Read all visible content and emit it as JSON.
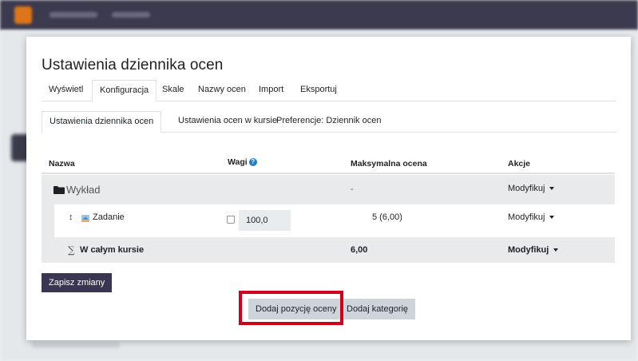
{
  "page": {
    "title": "Ustawienia dziennika ocen"
  },
  "tabs_primary": [
    {
      "label": "Wyświetl",
      "active": false
    },
    {
      "label": "Konfiguracja",
      "active": true
    },
    {
      "label": "Skale",
      "active": false
    },
    {
      "label": "Nazwy ocen",
      "active": false
    },
    {
      "label": "Import",
      "active": false
    },
    {
      "label": "Eksportuj",
      "active": false
    }
  ],
  "tabs_secondary": [
    {
      "label": "Ustawienia dziennika ocen",
      "active": true
    },
    {
      "label": "Ustawienia ocen w kursie",
      "active": false
    },
    {
      "label": "Preferencje: Dziennik ocen",
      "active": false
    }
  ],
  "table": {
    "headers": {
      "name": "Nazwa",
      "weights": "Wagi",
      "max_grade": "Maksymalna ocena",
      "actions": "Akcje"
    },
    "category_row": {
      "name": "Wykład",
      "max_grade": "-",
      "action": "Modyfikuj"
    },
    "item_row": {
      "name": "Zadanie",
      "weight_checked": false,
      "weight_value": "100,0",
      "max_grade": "5 (6,00)",
      "action": "Modyfikuj"
    },
    "total_row": {
      "symbol": "∑",
      "name": "W całym kursie",
      "max_grade": "6,00",
      "action": "Modyfikuj"
    }
  },
  "buttons": {
    "save": "Zapisz zmiany",
    "add_grade_item": "Dodaj pozycję oceny",
    "add_category": "Dodaj kategorię"
  },
  "icons": {
    "help": "question-circle-icon",
    "folder": "folder-icon",
    "move": "move-icon",
    "assignment": "assignment-icon",
    "caret": "caret-down-icon"
  },
  "colors": {
    "navbar": "#3c3a4e",
    "primary_button": "#3a3551",
    "secondary_button": "#ced4da",
    "highlight": "#d0021b",
    "row_shade": "#e9eaeb"
  }
}
